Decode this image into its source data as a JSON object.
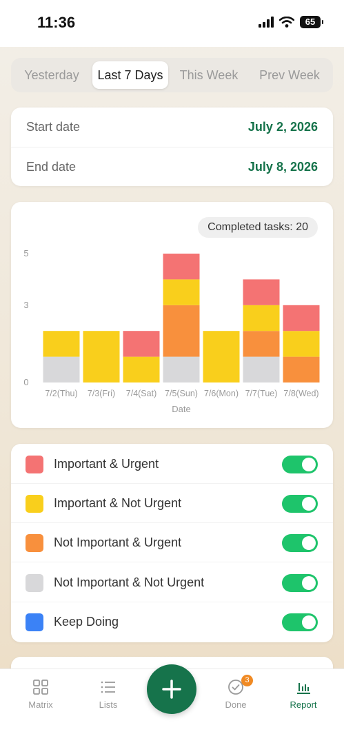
{
  "status_bar": {
    "time": "11:36",
    "battery": "65"
  },
  "segments": [
    {
      "label": "Yesterday",
      "active": false
    },
    {
      "label": "Last 7 Days",
      "active": true
    },
    {
      "label": "This Week",
      "active": false
    },
    {
      "label": "Prev Week",
      "active": false
    }
  ],
  "date_range": {
    "start_label": "Start date",
    "start_value": "July 2, 2026",
    "end_label": "End date",
    "end_value": "July 8, 2026"
  },
  "completed_badge": "Completed tasks: 20",
  "colors": {
    "important_urgent": "#f47373",
    "important_not_urgent": "#f9cf1c",
    "not_important_urgent": "#f8903d",
    "not_important_not_urgent": "#d8d8da",
    "keep_doing": "#3b82f6",
    "accent": "#16734b",
    "toggle_on": "#1ec46b"
  },
  "chart_data": {
    "type": "bar",
    "stacked": true,
    "xlabel": "Date",
    "ylabel": "",
    "ylim": [
      0,
      5
    ],
    "yticks": [
      0,
      3,
      5
    ],
    "categories": [
      "7/2(Thu)",
      "7/3(Fri)",
      "7/4(Sat)",
      "7/5(Sun)",
      "7/6(Mon)",
      "7/7(Tue)",
      "7/8(Wed)"
    ],
    "series": [
      {
        "name": "Not Important & Not Urgent",
        "color": "#d8d8da",
        "values": [
          1,
          0,
          0,
          1,
          0,
          1,
          0
        ]
      },
      {
        "name": "Not Important & Urgent",
        "color": "#f8903d",
        "values": [
          0,
          0,
          0,
          2,
          0,
          1,
          1
        ]
      },
      {
        "name": "Important & Not Urgent",
        "color": "#f9cf1c",
        "values": [
          1,
          2,
          1,
          1,
          2,
          1,
          1
        ]
      },
      {
        "name": "Important & Urgent",
        "color": "#f47373",
        "values": [
          0,
          0,
          1,
          1,
          0,
          1,
          1
        ]
      }
    ]
  },
  "legend": [
    {
      "label": "Important & Urgent",
      "color": "#f47373",
      "enabled": true
    },
    {
      "label": "Important & Not Urgent",
      "color": "#f9cf1c",
      "enabled": true
    },
    {
      "label": "Not Important & Urgent",
      "color": "#f8903d",
      "enabled": true
    },
    {
      "label": "Not Important & Not Urgent",
      "color": "#d8d8da",
      "enabled": true
    },
    {
      "label": "Keep Doing",
      "color": "#3b82f6",
      "enabled": true
    }
  ],
  "tab_bar": {
    "matrix": "Matrix",
    "lists": "Lists",
    "done": "Done",
    "done_badge": "3",
    "report": "Report",
    "active": "report"
  }
}
